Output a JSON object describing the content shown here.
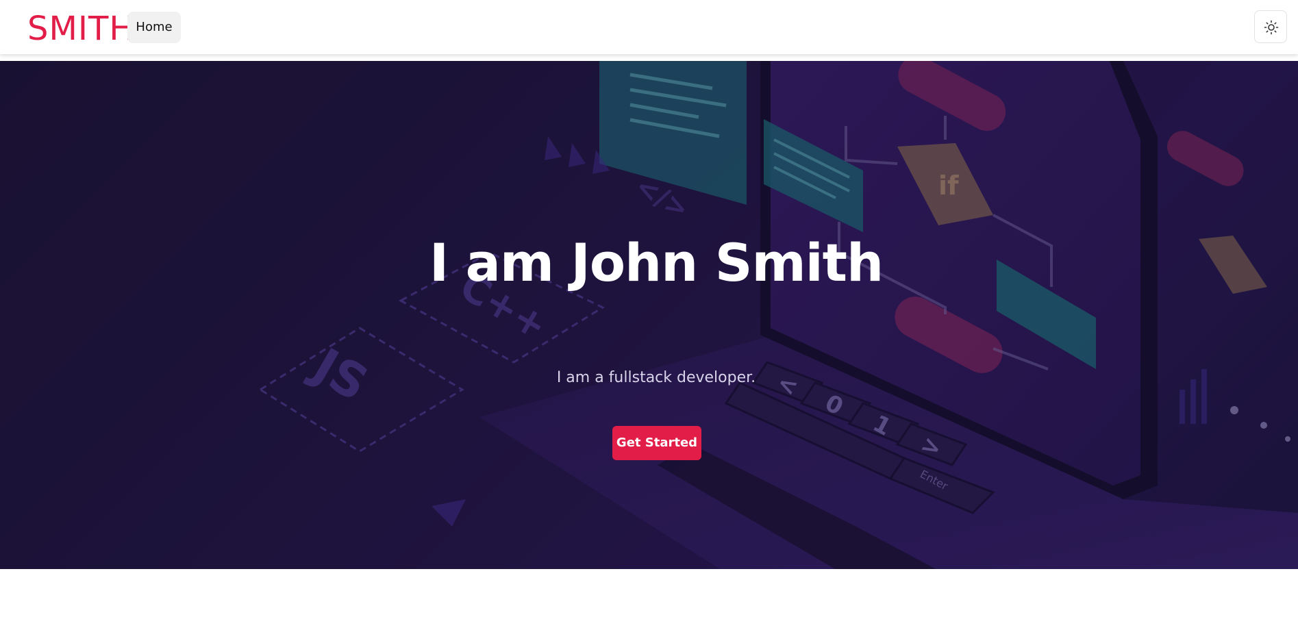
{
  "colors": {
    "brand": "#e11d48",
    "hero_bg": "#221745",
    "nav_bg": "#ffffff"
  },
  "navbar": {
    "logo": "SMITH",
    "items": [
      {
        "label": "Home"
      }
    ],
    "theme_toggle_icon": "sun-icon"
  },
  "hero": {
    "title": "I am John Smith",
    "subtitle": "I am a fullstack developer.",
    "cta_label": "Get Started",
    "background_image": "illustration of a laptop with code windows and flowchart",
    "background_labels": {
      "js": "JS",
      "cpp": "C++",
      "tag": "</>",
      "if": "if",
      "keys": [
        "<",
        "0",
        "1",
        ">"
      ],
      "enter": "Enter"
    }
  }
}
